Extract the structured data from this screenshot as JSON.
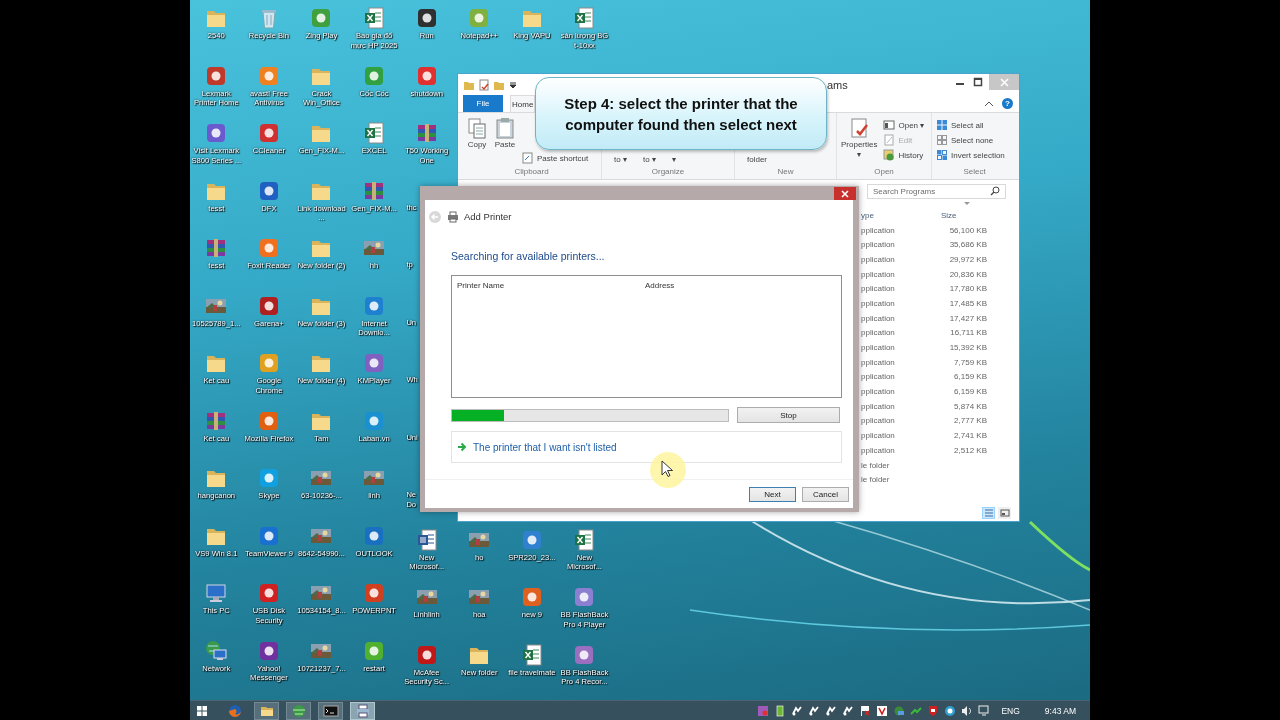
{
  "desktop": {
    "columns": [
      {
        "top": [
          {
            "kind": "folder",
            "label": "2540"
          },
          {
            "kind": "app",
            "color": "#c0392b",
            "label": "Lexmark Printer Home"
          },
          {
            "kind": "app",
            "color": "#6a5acd",
            "label": "Visit Lexmark S800 Series ..."
          },
          {
            "kind": "folder",
            "label": "tesst"
          },
          {
            "kind": "archive",
            "label": "tesst"
          },
          {
            "label": "10525789_1..."
          },
          {
            "kind": "folder",
            "label": "Ket cau"
          },
          {
            "kind": "archive",
            "label": "Ket cau"
          },
          {
            "kind": "folder",
            "label": "hangcanon"
          },
          {
            "kind": "folder",
            "label": "VS9 Win 8.1"
          },
          {
            "kind": "pc",
            "label": "This PC"
          },
          {
            "kind": "network",
            "label": "Network"
          }
        ]
      },
      {
        "top": [
          {
            "kind": "recycle",
            "label": "Recycle Bin"
          },
          {
            "kind": "app",
            "color": "#f08020",
            "label": "avast! Free Antivirus"
          },
          {
            "kind": "app",
            "color": "#d03030",
            "label": "CCleaner"
          },
          {
            "kind": "app",
            "color": "#2060c0",
            "label": "DFX"
          },
          {
            "kind": "app",
            "color": "#f07020",
            "label": "Foxit Reader"
          },
          {
            "kind": "app",
            "color": "#b02020",
            "label": "Garena+"
          },
          {
            "kind": "app",
            "color": "#e0a020",
            "label": "Google Chrome"
          },
          {
            "kind": "app",
            "color": "#e06010",
            "label": "Mozilla Firefox"
          },
          {
            "kind": "app",
            "color": "#10a0e0",
            "label": "Skype"
          },
          {
            "kind": "app",
            "color": "#1a70d0",
            "label": "TeamViewer 9"
          },
          {
            "kind": "app",
            "color": "#d02020",
            "label": "USB Disk Security"
          },
          {
            "kind": "app",
            "color": "#7030a0",
            "label": "Yahoo! Messenger"
          }
        ]
      },
      {
        "top": [
          {
            "kind": "app",
            "color": "#40a040",
            "label": "Zing Play"
          },
          {
            "kind": "folder",
            "label": "Crack Win_Office"
          },
          {
            "kind": "folder",
            "label": "Gen_FIX-M..."
          },
          {
            "kind": "folder",
            "label": "Link download ..."
          },
          {
            "kind": "folder",
            "label": "New folder (2)"
          },
          {
            "kind": "folder",
            "label": "New folder (3)"
          },
          {
            "kind": "folder",
            "label": "New folder (4)"
          },
          {
            "kind": "folder",
            "label": "Tam"
          },
          {
            "label": "63-10236-..."
          },
          {
            "label": "8642-54990..."
          },
          {
            "label": "10534154_8..."
          },
          {
            "label": "10721237_7..."
          }
        ]
      },
      {
        "top": [
          {
            "kind": "excel",
            "label": "Bao gia đổ mực HP 2025"
          },
          {
            "kind": "app",
            "color": "#30a040",
            "label": "Cốc Cốc"
          },
          {
            "kind": "excel",
            "label": "EXCEL"
          },
          {
            "kind": "archive",
            "label": "Gen_FIX-M..."
          },
          {
            "label": "hh"
          },
          {
            "kind": "app",
            "color": "#2080d0",
            "label": "Internet Downlo..."
          },
          {
            "kind": "app",
            "color": "#8060c0",
            "label": "KMPlayer"
          },
          {
            "kind": "app",
            "color": "#1a90d0",
            "label": "Laban.vn"
          },
          {
            "label": "linh"
          },
          {
            "kind": "app",
            "color": "#1a70c0",
            "label": "OUTLOOK"
          },
          {
            "kind": "app",
            "color": "#d04020",
            "label": "POWERPNT"
          },
          {
            "kind": "app",
            "color": "#50b030",
            "label": "restart"
          }
        ]
      },
      {
        "top": [
          {
            "kind": "app",
            "color": "#303030",
            "label": "Run"
          },
          {
            "kind": "app",
            "color": "#e03030",
            "label": "shutdown"
          },
          {
            "kind": "archive",
            "label": "T50 Working One"
          },
          {
            "kind": "clipped",
            "label": "thc"
          },
          {
            "kind": "clipped",
            "label": "tp"
          },
          {
            "kind": "clipped",
            "label": "Un"
          },
          {
            "kind": "clipped",
            "label": "Wh"
          },
          {
            "kind": "clipped",
            "label": "Uni"
          },
          {
            "kind": "clipped",
            "label": "Ne Do"
          }
        ],
        "bottom": [
          {
            "kind": "word",
            "label": "New Microsof..."
          },
          {
            "label": "Linhlinh"
          },
          {
            "kind": "app",
            "color": "#c01818",
            "label": "McAfee Security Sc..."
          }
        ]
      },
      {
        "top": [
          {
            "kind": "app",
            "color": "#80b040",
            "label": "Notepad++"
          }
        ],
        "bottom": [
          {
            "label": "ho"
          },
          {
            "label": "hoa"
          },
          {
            "kind": "folder",
            "label": "New folder"
          }
        ]
      },
      {
        "top": [
          {
            "kind": "folder",
            "label": "King VAPU"
          }
        ],
        "bottom": [
          {
            "kind": "app",
            "color": "#3080d0",
            "label": "SPR220_23..."
          },
          {
            "kind": "app",
            "color": "#e06020",
            "label": "new  9"
          },
          {
            "kind": "excel",
            "label": "file travelmate"
          }
        ]
      },
      {
        "top": [
          {
            "kind": "excel",
            "label": "sản lượng BG t-10xx"
          }
        ],
        "bottom": [
          {
            "kind": "excel",
            "label": "New Microsof..."
          },
          {
            "kind": "app",
            "color": "#8a7fd0",
            "label": "BB FlashBack Pro 4 Player"
          },
          {
            "kind": "app",
            "color": "#9a6fc0",
            "label": "BB FlashBack Pro 4 Recor..."
          }
        ]
      }
    ]
  },
  "explorer": {
    "title": "ams",
    "help": "?",
    "ribbon_tabs": [
      {
        "label": "File",
        "selected": false
      },
      {
        "label": "Home",
        "selected": true
      }
    ],
    "ribbon_groups": [
      {
        "label": "Clipboard",
        "items": [
          {
            "kind": "large",
            "label": "Copy",
            "disabled": false
          },
          {
            "kind": "large",
            "label": "Paste",
            "disabled": false
          },
          {
            "kind": "small",
            "label": "Paste shortcut",
            "disabled": false
          }
        ]
      },
      {
        "label": "Organize",
        "items": [
          {
            "kind": "bare",
            "label": "to ▾",
            "disabled": false
          },
          {
            "kind": "bare",
            "label": "to ▾",
            "disabled": false
          },
          {
            "kind": "bare",
            "label": "▾",
            "disabled": false
          }
        ]
      },
      {
        "label": "New",
        "items": [
          {
            "kind": "bare",
            "label": "folder",
            "disabled": false
          }
        ]
      },
      {
        "label": "Open",
        "items": [
          {
            "kind": "large",
            "label": "Properties\n▾",
            "disabled": false
          },
          {
            "kind": "small",
            "label": "Open ▾",
            "disabled": false
          },
          {
            "kind": "small",
            "label": "Edit",
            "disabled": true
          },
          {
            "kind": "small",
            "label": "History",
            "disabled": false
          }
        ]
      },
      {
        "label": "Select",
        "items": [
          {
            "kind": "small",
            "label": "Select all",
            "disabled": false
          },
          {
            "kind": "small",
            "label": "Select none",
            "disabled": false
          },
          {
            "kind": "small",
            "label": "Invert selection",
            "disabled": false
          }
        ]
      }
    ],
    "search": {
      "placeholder": "Search Programs"
    },
    "columns": [
      "ype",
      "Size"
    ],
    "rows": [
      {
        "type": "pplication",
        "size": "56,100 KB"
      },
      {
        "type": "pplication",
        "size": "35,686 KB"
      },
      {
        "type": "pplication",
        "size": "29,972 KB"
      },
      {
        "type": "pplication",
        "size": "20,836 KB"
      },
      {
        "type": "pplication",
        "size": "17,780 KB"
      },
      {
        "type": "pplication",
        "size": "17,485 KB"
      },
      {
        "type": "pplication",
        "size": "17,427 KB"
      },
      {
        "type": "pplication",
        "size": "16,711 KB"
      },
      {
        "type": "pplication",
        "size": "15,392 KB"
      },
      {
        "type": "pplication",
        "size": "7,759 KB"
      },
      {
        "type": "pplication",
        "size": "6,159 KB"
      },
      {
        "type": "pplication",
        "size": "6,159 KB"
      },
      {
        "type": "pplication",
        "size": "5,874 KB"
      },
      {
        "type": "pplication",
        "size": "2,777 KB"
      },
      {
        "type": "pplication",
        "size": "2,741 KB"
      },
      {
        "type": "pplication",
        "size": "2,512 KB"
      },
      {
        "type": "le folder"
      },
      {
        "type": "le folder"
      }
    ],
    "views": [
      {
        "kind": "details",
        "selected": true
      },
      {
        "kind": "tiles",
        "selected": false
      }
    ]
  },
  "dialog": {
    "title": "Add Printer",
    "heading": "Searching for available printers...",
    "columns": [
      "Printer Name",
      "Address"
    ],
    "progress": {
      "level": 0.19
    },
    "stop": "Stop",
    "link": "The printer that I want isn't listed",
    "buttons": [
      {
        "label": "Next",
        "default": true
      },
      {
        "label": "Cancel",
        "default": false
      }
    ]
  },
  "callout": {
    "text": "Step 4: select the printer that the computer found then select next"
  },
  "taskbar": {
    "apps": [
      {
        "kind": "browser",
        "open": false,
        "selected": false
      },
      {
        "kind": "folder",
        "open": true,
        "selected": false
      },
      {
        "kind": "globe",
        "open": true,
        "selected": false
      },
      {
        "kind": "terminal",
        "open": true,
        "selected": false
      },
      {
        "kind": "printer",
        "open": true,
        "selected": true
      }
    ],
    "tray": [
      {
        "kind": "app"
      },
      {
        "kind": "battery"
      },
      {
        "kind": "sync"
      },
      {
        "kind": "sync"
      },
      {
        "kind": "sync"
      },
      {
        "kind": "sync"
      },
      {
        "kind": "flag"
      },
      {
        "kind": "antivirus"
      },
      {
        "kind": "network"
      },
      {
        "kind": "arrows"
      },
      {
        "kind": "shield"
      },
      {
        "kind": "circle"
      },
      {
        "kind": "volume"
      },
      {
        "kind": "display"
      }
    ],
    "language": "ENG",
    "time": "9:43 AM"
  }
}
